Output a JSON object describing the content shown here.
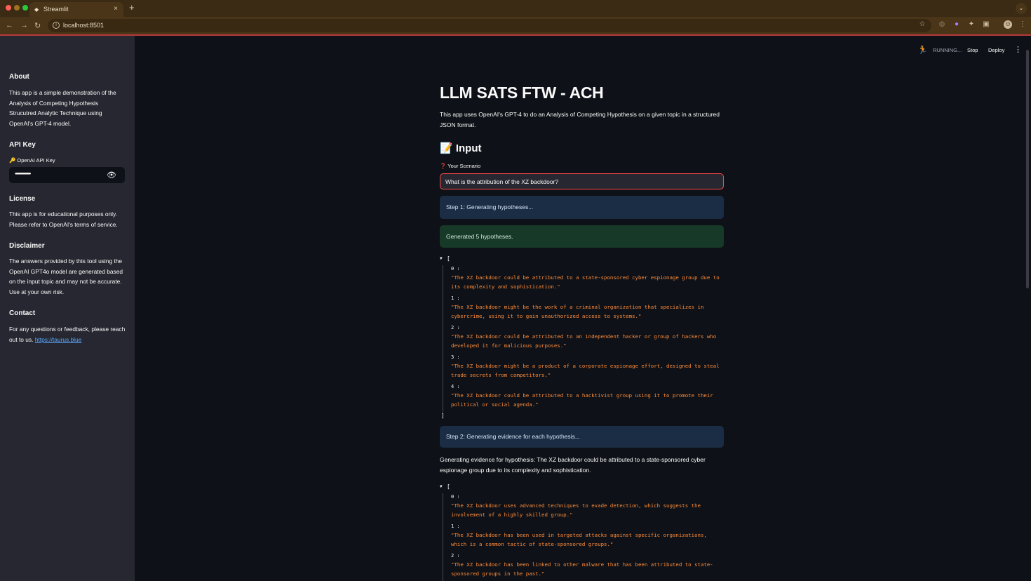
{
  "browser": {
    "tab_title": "Streamlit",
    "url": "localhost:8501"
  },
  "sidebar": {
    "about": {
      "heading": "About",
      "text": "This app is a simple demonstration of the Analysis of Competing Hypothesis Strucutred Analytic Technique using OpenAI's GPT-4 model."
    },
    "api_key": {
      "heading": "API Key",
      "label": "🔑 OpenAI API Key",
      "value": "••••••••••••••••••••••••••••••••••••••••••••••••••••"
    },
    "license": {
      "heading": "License",
      "text": "This app is for educational purposes only. Please refer to OpenAI's terms of service."
    },
    "disclaimer": {
      "heading": "Disclaimer",
      "text": "The answers provided by this tool using the OpenAI GPT4o model are generated based on the input topic and may not be accurate. Use at your own risk."
    },
    "contact": {
      "heading": "Contact",
      "text": "For any questions or feedback, please reach out to us.",
      "link": "https://taurus.blue"
    }
  },
  "toolbar": {
    "status": "RUNNING...",
    "stop": "Stop",
    "deploy": "Deploy",
    "menu": "⋮"
  },
  "main": {
    "title": "LLM SATS FTW - ACH",
    "intro": "This app uses OpenAI's GPT-4 to do an Analysis of Competing Hypothesis on a given topic in a structured JSON format.",
    "input_heading": "📝 Input",
    "scenario_label": "❓ Your Scenario",
    "scenario_value": "What is the attribution of the XZ backdoor?",
    "step1": "Step 1: Generating hypotheses...",
    "generated": "Generated 5 hypotheses.",
    "hypotheses": [
      "\"The XZ backdoor could be attributed to a state-sponsored cyber espionage group due to its complexity and sophistication.\"",
      "\"The XZ backdoor might be the work of a criminal organization that specializes in cybercrime, using it to gain unauthorized access to systems.\"",
      "\"The XZ backdoor could be attributed to an independent hacker or group of hackers who developed it for malicious purposes.\"",
      "\"The XZ backdoor might be a product of a corporate espionage effort, designed to steal trade secrets from competitors.\"",
      "\"The XZ backdoor could be attributed to a hacktivist group using it to promote their political or social agenda.\""
    ],
    "step2": "Step 2: Generating evidence for each hypothesis...",
    "evidence_intro": "Generating evidence for hypothesis: The XZ backdoor could be attributed to a state-sponsored cyber espionage group due to its complexity and sophistication.",
    "evidence": [
      "\"The XZ backdoor uses advanced techniques to evade detection, which suggests the involvement of a highly skilled group.\"",
      "\"The XZ backdoor has been used in targeted attacks against specific organizations, which is a common tactic of state-sponsored groups.\"",
      "\"The XZ backdoor has been linked to other malware that has been attributed to state-sponsored groups in the past.\""
    ],
    "json_open": "[",
    "json_close": "]",
    "idx": [
      "0 :",
      "1 :",
      "2 :",
      "3 :",
      "4 :"
    ]
  }
}
